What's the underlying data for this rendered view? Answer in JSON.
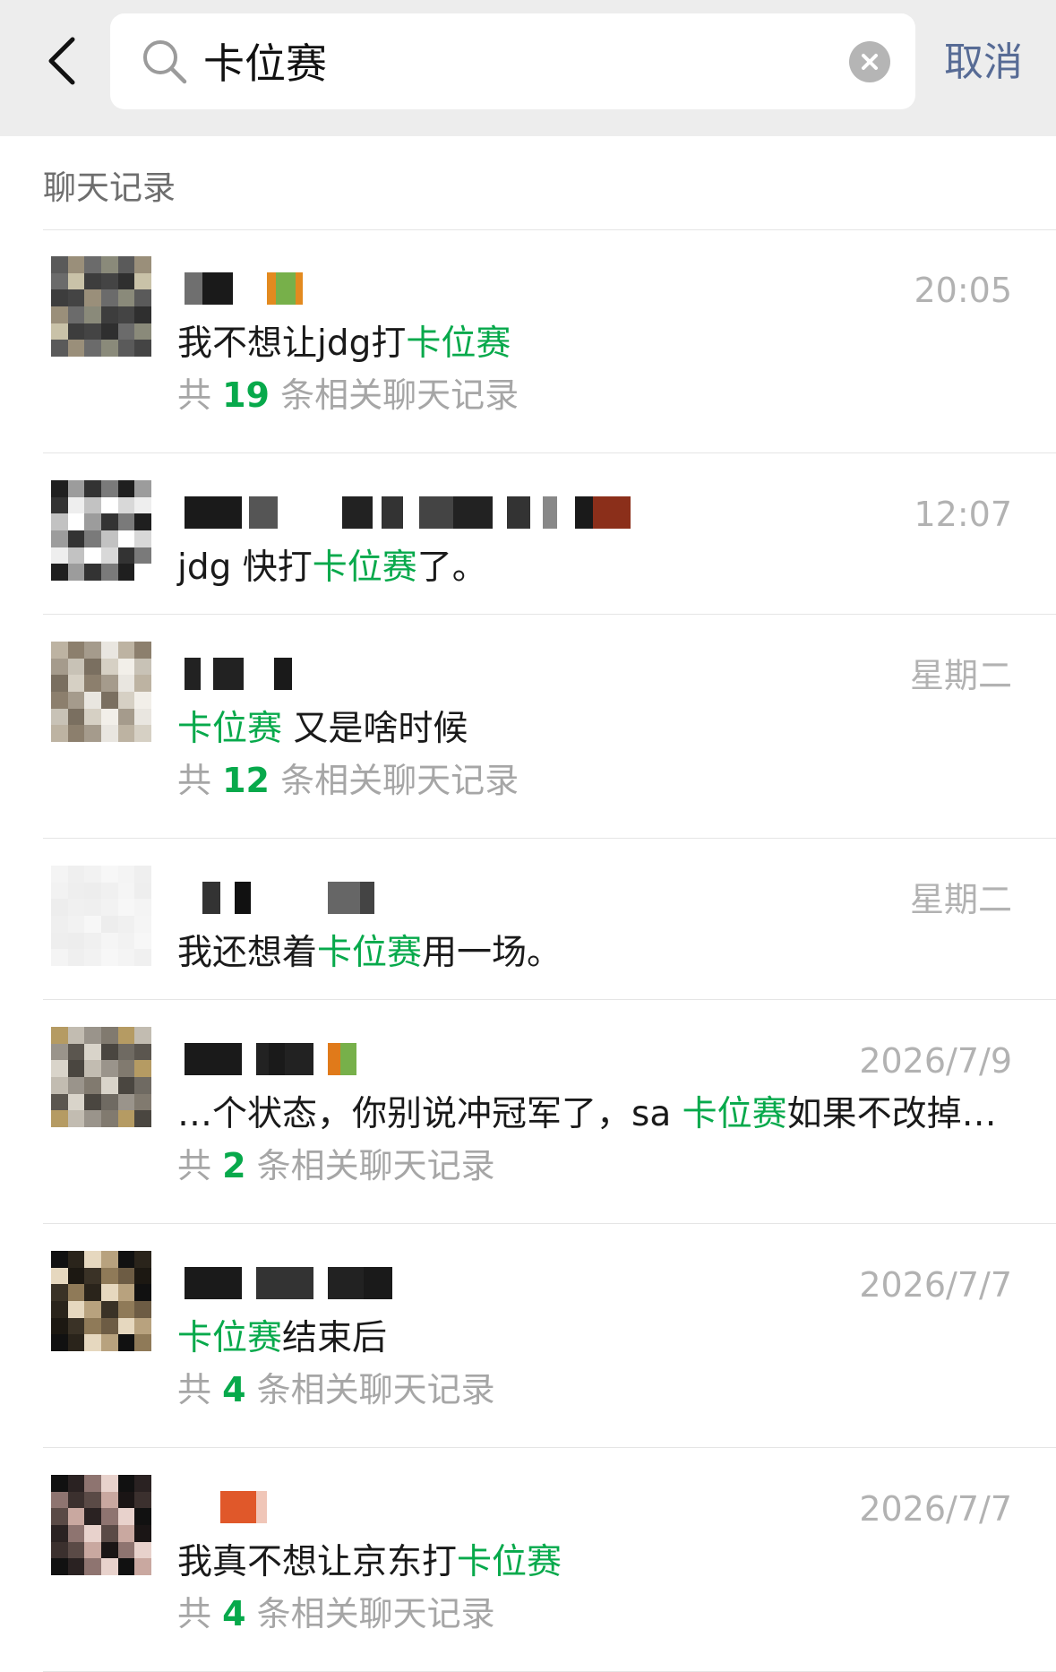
{
  "search": {
    "query": "卡位赛",
    "cancel_label": "取消"
  },
  "section": {
    "title": "聊天记录"
  },
  "results": [
    {
      "time": "20:05",
      "pre": "我不想让jdg打",
      "match": "卡位赛",
      "post": "",
      "count_prefix": "共",
      "count": "19",
      "count_suffix": "条相关聊天记录"
    },
    {
      "time": "12:07",
      "pre": "jdg 快打",
      "match": "卡位赛",
      "post": "了。"
    },
    {
      "time": "星期二",
      "pre": "",
      "match": "卡位赛",
      "post": " 又是啥时候",
      "count_prefix": "共",
      "count": "12",
      "count_suffix": "条相关聊天记录"
    },
    {
      "time": "星期二",
      "pre": "我还想着",
      "match": "卡位赛",
      "post": "用一场。"
    },
    {
      "time": "2026/7/9",
      "pre": "…个状态，你别说冲冠军了，sa ",
      "match": "卡位赛",
      "post": "如果不改掉…",
      "count_prefix": "共",
      "count": "2",
      "count_suffix": "条相关聊天记录"
    },
    {
      "time": "2026/7/7",
      "pre": "",
      "match": "卡位赛",
      "post": "结束后",
      "count_prefix": "共",
      "count": "4",
      "count_suffix": "条相关聊天记录"
    },
    {
      "time": "2026/7/7",
      "pre": "我真不想让京东打",
      "match": "卡位赛",
      "post": "",
      "count_prefix": "共",
      "count": "4",
      "count_suffix": "条相关聊天记录"
    }
  ],
  "colors": {
    "highlight": "#07a94b",
    "link": "#576b95",
    "header_bg": "#ededed"
  },
  "icons": [
    "back-chevron-icon",
    "search-icon",
    "clear-icon"
  ]
}
